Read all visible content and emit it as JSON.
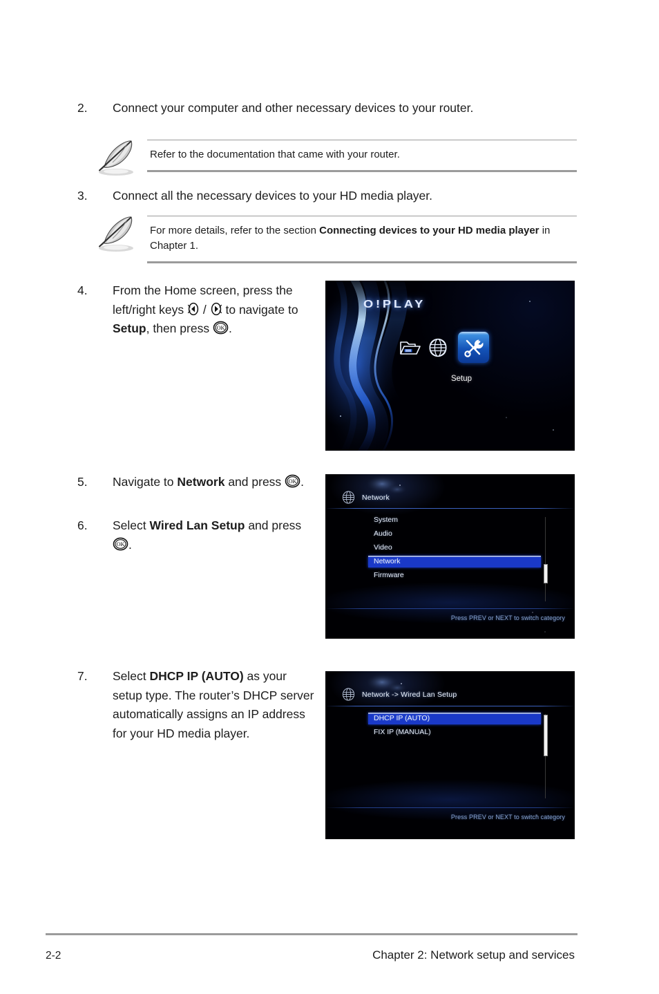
{
  "document": {
    "steps": [
      {
        "number": "2.",
        "text": "Connect your computer and other necessary devices to your router."
      },
      {
        "number": "3.",
        "text": "Connect all the necessary devices to your HD media player."
      },
      {
        "number": "4.",
        "line1": "From the Home screen, press the",
        "line2_a": "left/right keys",
        "line2_sep": "/",
        "line2_b": "to navigate to",
        "line3_bold": "Setup",
        "line3_tail": ", then press",
        "line3_end": "."
      },
      {
        "number": "5.",
        "pre": "Navigate to",
        "bold": "Network",
        "post": "and press",
        "end": "."
      },
      {
        "number": "6.",
        "pre": "Select",
        "bold": "Wired Lan Setup",
        "post": "and",
        "press": "press",
        "end": "."
      },
      {
        "number": "7.",
        "pre": "Select",
        "bold": "DHCP IP (AUTO)",
        "post": "as your setup type. The router’s DHCP server automatically assigns an IP address for your HD media player."
      }
    ],
    "notes": [
      {
        "text": "Refer to the documentation that came with your router."
      },
      {
        "pre": "For more details, refer to the section ",
        "bold": "Connecting devices to your HD media player",
        "post": " in Chapter 1."
      }
    ],
    "footer": {
      "page_number": "2-2",
      "chapter": "Chapter 2:  Network setup and services"
    }
  },
  "screenshots": {
    "home": {
      "logo": "O!PLAY",
      "setup_label": "Setup",
      "icons": [
        "folder-icon",
        "globe-icon",
        "setup-tools-icon"
      ],
      "accent": "#1453b8"
    },
    "network_menu": {
      "title": "Network",
      "items": [
        "System",
        "Audio",
        "Video",
        "Network",
        "Firmware"
      ],
      "selected": "Network",
      "hint": "Press PREV or NEXT to switch category",
      "highlight_color": "#1a39c8"
    },
    "wired_lan_menu": {
      "title": "Network -> Wired Lan Setup",
      "items": [
        "DHCP IP (AUTO)",
        "FIX IP (MANUAL)"
      ],
      "selected": "DHCP IP (AUTO)",
      "hint": "Press PREV or NEXT to switch category",
      "highlight_color": "#1a39c8"
    }
  }
}
